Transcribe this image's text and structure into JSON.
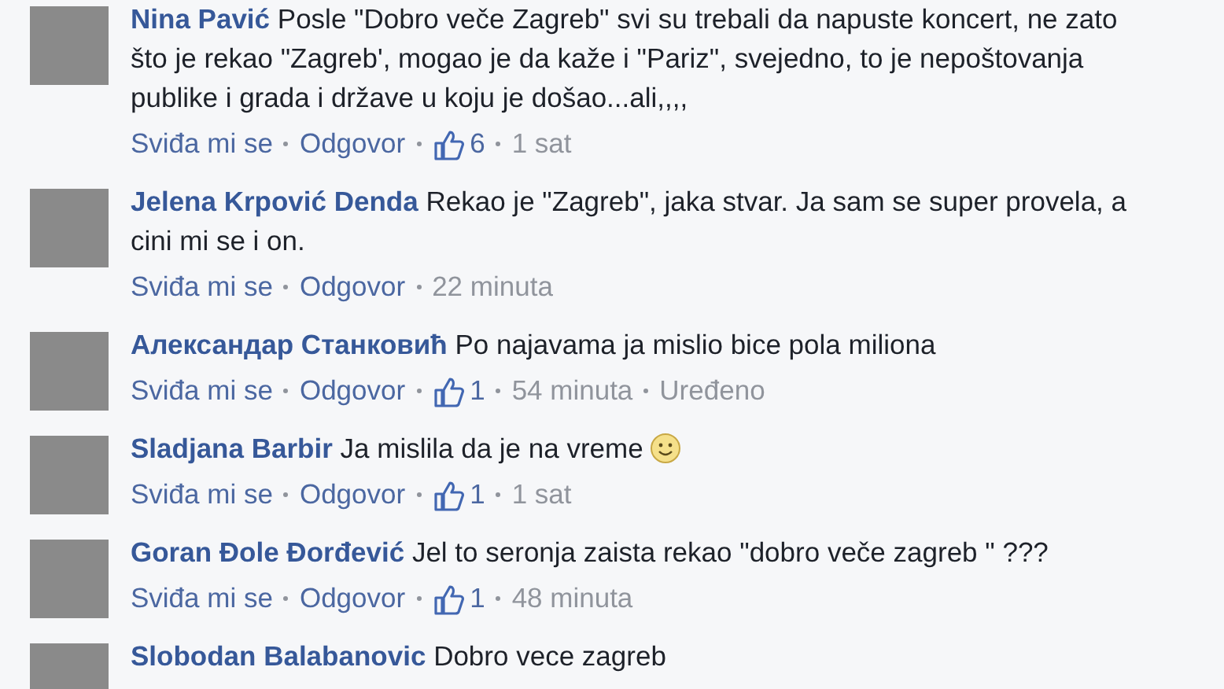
{
  "comments": [
    {
      "author": "Nina Pavić",
      "text": "Posle \"Dobro veče Zagreb\" svi su trebali da napuste koncert, ne zato što je rekao \"Zagreb', mogao je da kaže i \"Pariz\", svejedno, to je nepoštovanja publike i grada i države u koju je došao...ali,,,,",
      "smiley": false,
      "like_label": "Sviđa mi se",
      "reply_label": "Odgovor",
      "likes": "6",
      "time": "1 sat"
    },
    {
      "author": "Jelena Krpović Denda",
      "text": "Rekao je \"Zagreb\", jaka stvar. Ja sam se super provela, a cini mi se i on.",
      "smiley": false,
      "like_label": "Sviđa mi se",
      "reply_label": "Odgovor",
      "time": "22 minuta"
    },
    {
      "author": "Александар Станковић",
      "text": "Po najavama ja mislio bice pola miliona",
      "smiley": false,
      "like_label": "Sviđa mi se",
      "reply_label": "Odgovor",
      "likes": "1",
      "time": "54 minuta",
      "edited": "Uređeno"
    },
    {
      "author": "Sladjana Barbir",
      "text": "Ja mislila da je na vreme",
      "smiley": true,
      "like_label": "Sviđa mi se",
      "reply_label": "Odgovor",
      "likes": "1",
      "time": "1 sat"
    },
    {
      "author": "Goran Đole Đorđević",
      "text": "Jel to seronja zaista rekao \"dobro veče zagreb \" ???",
      "smiley": false,
      "like_label": "Sviđa mi se",
      "reply_label": "Odgovor",
      "likes": "1",
      "time": "48 minuta"
    },
    {
      "author": "Slobodan Balabanovic",
      "text": "Dobro vece zagreb",
      "smiley": false
    }
  ]
}
